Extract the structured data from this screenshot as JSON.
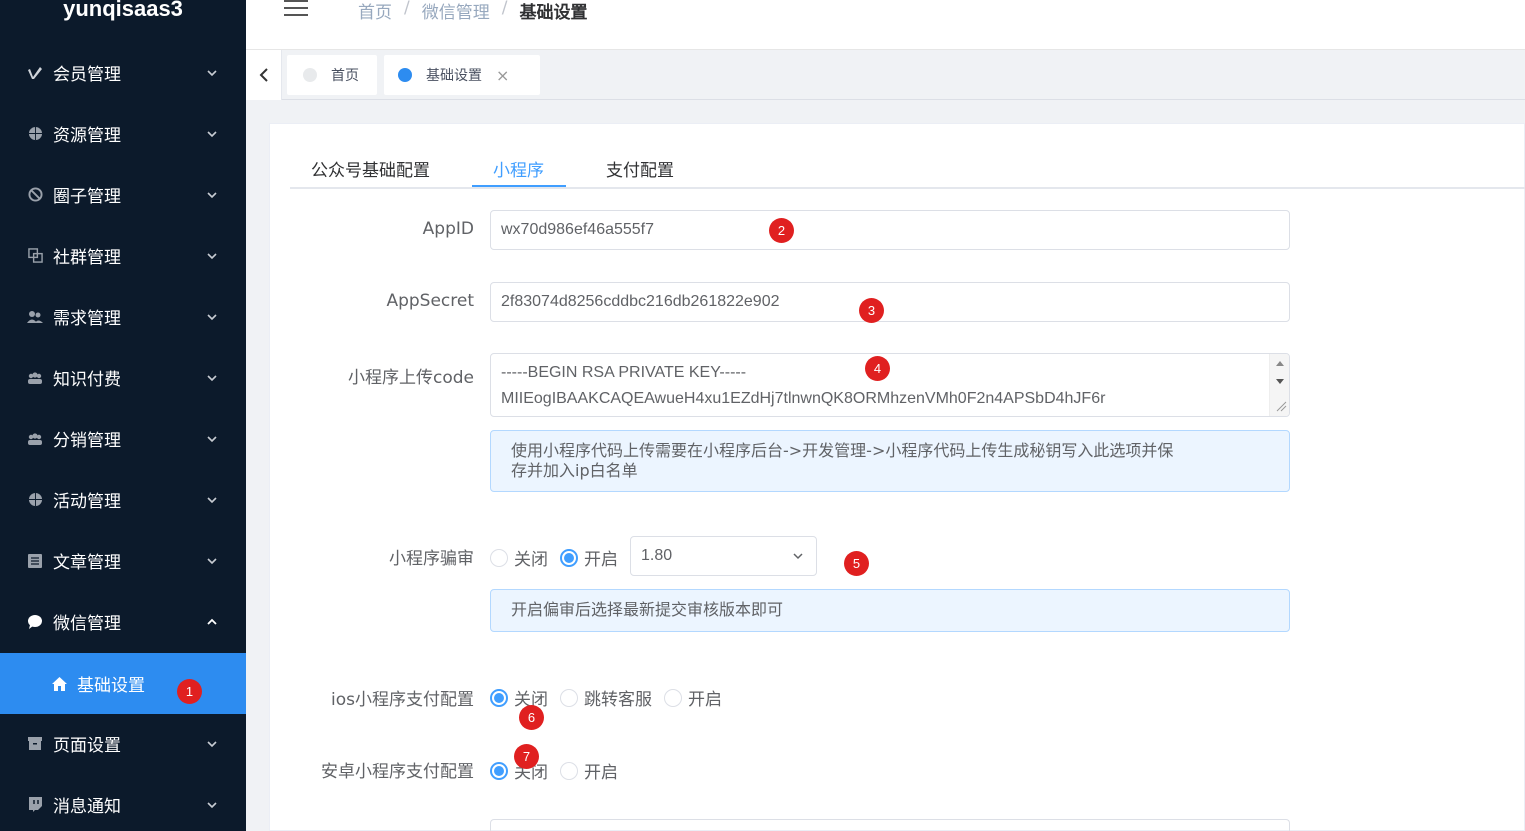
{
  "app": {
    "logo": "yunqisaas3"
  },
  "sidebar": {
    "items": [
      {
        "label": "会员管理",
        "icon": "vimeo-icon"
      },
      {
        "label": "资源管理",
        "icon": "basketball-icon"
      },
      {
        "label": "圈子管理",
        "icon": "circle-slash-icon"
      },
      {
        "label": "社群管理",
        "icon": "copy-icon"
      },
      {
        "label": "需求管理",
        "icon": "users-icon"
      },
      {
        "label": "知识付费",
        "icon": "group-icon"
      },
      {
        "label": "分销管理",
        "icon": "group-icon"
      },
      {
        "label": "活动管理",
        "icon": "basketball-icon"
      },
      {
        "label": "文章管理",
        "icon": "list-icon"
      },
      {
        "label": "微信管理",
        "icon": "chat-icon"
      },
      {
        "label": "页面设置",
        "icon": "box-icon"
      },
      {
        "label": "消息通知",
        "icon": "twitch-icon"
      }
    ],
    "sub_item": {
      "label": "基础设置",
      "icon": "home-icon"
    }
  },
  "header": {
    "breadcrumb": [
      "首页",
      "微信管理",
      "基础设置"
    ]
  },
  "tagsbar": {
    "tags": [
      {
        "label": "首页",
        "active": false
      },
      {
        "label": "基础设置",
        "active": true,
        "close": "×"
      }
    ]
  },
  "tabs": [
    "公众号基础配置",
    "小程序",
    "支付配置"
  ],
  "form": {
    "appid": {
      "label": "AppID",
      "value": "wx70d986ef46a555f7"
    },
    "appsecret": {
      "label": "AppSecret",
      "value": "2f83074d8256cddbc216db261822e902"
    },
    "upload_code": {
      "label": "小程序上传code",
      "line1": "-----BEGIN RSA PRIVATE KEY-----",
      "line2": "MIIEogIBAAKCAQEAwueH4xu1EZdHj7tlnwnQK8ORMhzenVMh0F2n4APSbD4hJF6r",
      "hint_line1": "使用小程序代码上传需要在小程序后台->开发管理->小程序代码上传生成秘钥写入此选项并保",
      "hint_line2": "存并加入ip白名单"
    },
    "review": {
      "label": "小程序骗审",
      "options": [
        "关闭",
        "开启"
      ],
      "selected": "开启",
      "version": "1.80",
      "hint": "开启偏审后选择最新提交审核版本即可"
    },
    "ios_pay": {
      "label": "ios小程序支付配置",
      "options": [
        "关闭",
        "跳转客服",
        "开启"
      ],
      "selected": "关闭"
    },
    "android_pay": {
      "label": "安卓小程序支付配置",
      "options": [
        "关闭",
        "开启"
      ],
      "selected": "关闭"
    }
  },
  "badges": [
    "1",
    "2",
    "3",
    "4",
    "5",
    "6",
    "7"
  ],
  "colors": {
    "sidebar_bg": "#0c1a2b",
    "accent": "#409eff",
    "active_menu": "#2d8cf0",
    "badge": "#e02020"
  }
}
